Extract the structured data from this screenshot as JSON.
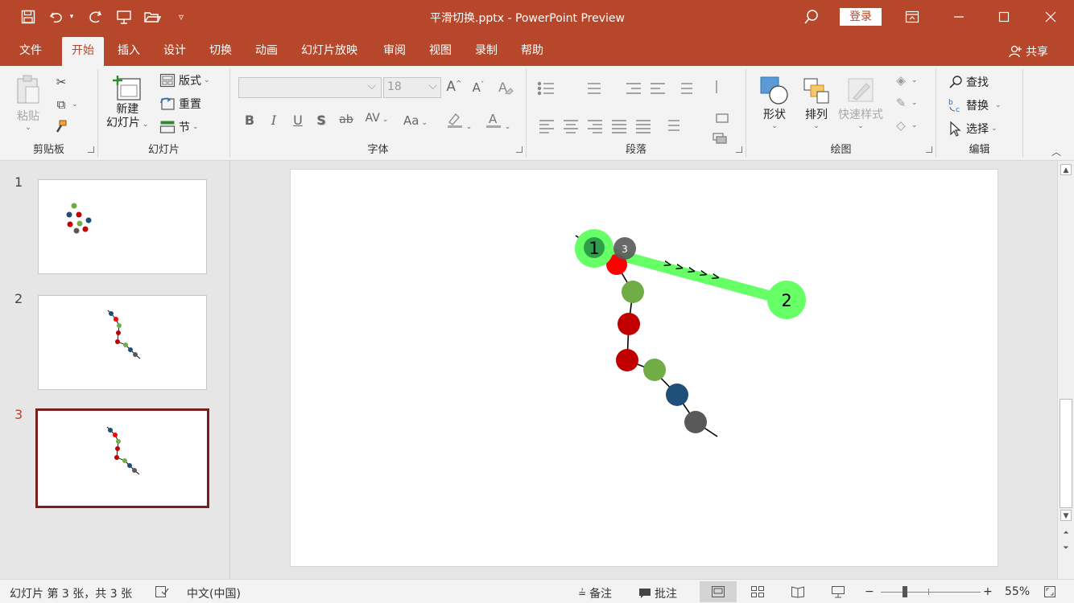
{
  "window": {
    "title": "平滑切换.pptx  -  PowerPoint Preview",
    "login_label": "登录"
  },
  "quick_access": {
    "icons": [
      "save-icon",
      "undo-icon",
      "redo-icon",
      "present-icon",
      "open-icon",
      "customize-icon"
    ]
  },
  "tabs": [
    {
      "label": "文件"
    },
    {
      "label": "开始"
    },
    {
      "label": "插入"
    },
    {
      "label": "设计"
    },
    {
      "label": "切换"
    },
    {
      "label": "动画"
    },
    {
      "label": "幻灯片放映"
    },
    {
      "label": "审阅"
    },
    {
      "label": "视图"
    },
    {
      "label": "录制"
    },
    {
      "label": "帮助"
    }
  ],
  "active_tab": "开始",
  "share_label": "共享",
  "ribbon": {
    "clipboard": {
      "group_label": "剪贴板",
      "paste_label": "粘贴"
    },
    "slides": {
      "group_label": "幻灯片",
      "new_slide_line1": "新建",
      "new_slide_line2": "幻灯片",
      "layout_label": "版式",
      "reset_label": "重置",
      "section_label": "节"
    },
    "font": {
      "group_label": "字体",
      "font_name": "",
      "font_size": "18",
      "grow_label": "A",
      "shrink_label": "A",
      "bold_label": "B",
      "italic_label": "I",
      "underline_label": "U",
      "shadow_label": "S",
      "strike_label": "ab",
      "spacing_label": "AV",
      "case_label": "Aa"
    },
    "paragraph": {
      "group_label": "段落"
    },
    "drawing": {
      "group_label": "绘图",
      "shapes_label": "形状",
      "arrange_label": "排列",
      "quick_styles_label": "快速样式"
    },
    "editing": {
      "group_label": "编辑",
      "find_label": "查找",
      "replace_label": "替换",
      "select_label": "选择"
    }
  },
  "thumbnails": [
    {
      "number": "1"
    },
    {
      "number": "2"
    },
    {
      "number": "3"
    }
  ],
  "selected_slide": 3,
  "slide": {
    "anchor1_label": "1",
    "anchor2_label": "2",
    "marker3_label": "3",
    "path_arrows": "> > > > >"
  },
  "status": {
    "slide_info": "幻灯片 第 3 张，共 3 张",
    "language": "中文(中国)",
    "notes_label": "备注",
    "comments_label": "批注",
    "zoom_out": "−",
    "zoom_in": "+",
    "zoom_level": "55%"
  },
  "colors": {
    "accent": "#b7472a",
    "red": "#c00000",
    "bright_red": "#ff0000",
    "green": "#70ad47",
    "blue": "#1f4e79",
    "gray": "#595959",
    "motion_green": "#66ff66"
  }
}
